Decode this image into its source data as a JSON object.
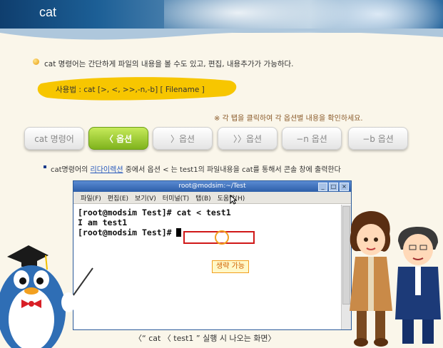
{
  "header": {
    "title": "cat"
  },
  "intro": {
    "text": "cat 명령어는 간단하게 파일의 내용을 볼 수도 있고, 편집, 내용추가가 가능하다."
  },
  "usage": {
    "text": "사용법 : cat  [>, <, >>,-n,-b] [ Filename ]"
  },
  "note": {
    "text": "※ 각 탭을 클릭하여 각 옵션별 내용을 확인하세요."
  },
  "tabs": [
    {
      "label": "cat 명령어"
    },
    {
      "label": "〈 옵션"
    },
    {
      "label": "〉옵션"
    },
    {
      "label": "〉〉옵션"
    },
    {
      "label": "−n 옵션"
    },
    {
      "label": "−b 옵션"
    }
  ],
  "active_tab": "〈 옵션",
  "description": {
    "prefix": "cat명령어의 ",
    "link": "리다이렉션",
    "suffix": " 중에서 옵션 < 는 test1의 파일내용을 cat를 통해서 콘솔 창에 출력한다"
  },
  "terminal": {
    "title": "root@modsim:~/Test",
    "menu": [
      "파일(F)",
      "편집(E)",
      "보기(V)",
      "터미널(T)",
      "탭(B)",
      "도움말(H)"
    ],
    "lines": [
      "[root@modsim Test]# cat < test1",
      "I am test1",
      "[root@modsim Test]# "
    ],
    "callout": "생략 가능"
  },
  "caption": "〈“ cat 〈 test1 ” 실행 시 나오는 화면〉",
  "colors": {
    "accent_green": "#7fb31d",
    "highlight_red": "#d01818",
    "callout_orange": "#f2a020"
  }
}
